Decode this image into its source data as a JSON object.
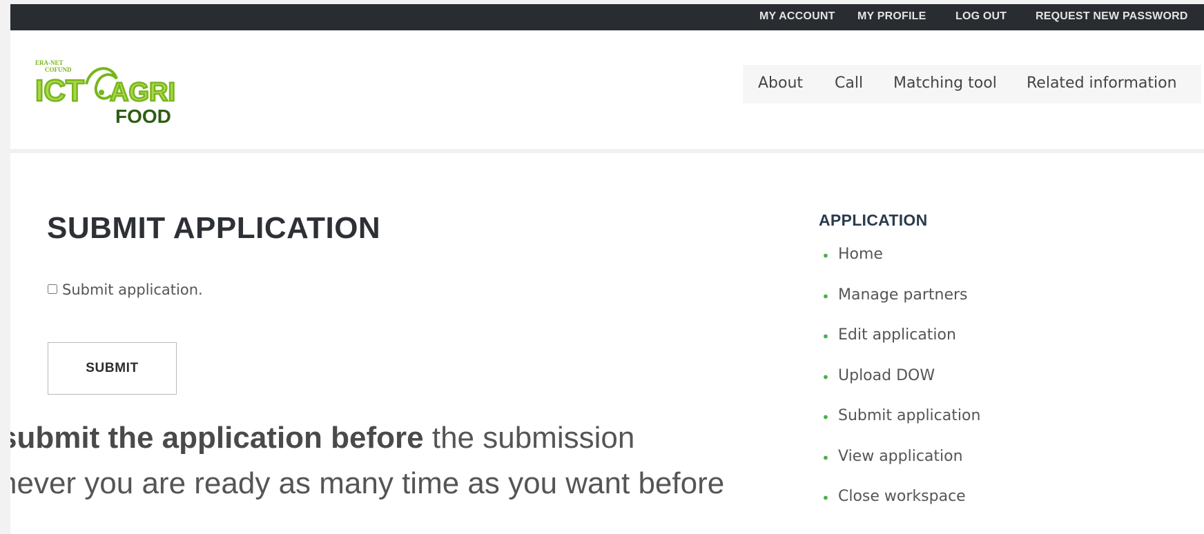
{
  "topbar": {
    "links": [
      {
        "label": "MY ACCOUNT"
      },
      {
        "label": "MY PROFILE"
      },
      {
        "label": "LOG OUT"
      },
      {
        "label": "REQUEST NEW PASSWORD"
      }
    ]
  },
  "logo": {
    "line1": "ERA-NET",
    "line2": "COFUND",
    "main_left": "ICT",
    "main_right": "AGRI",
    "sub": "FOOD",
    "brand_color": "#78b51c",
    "dark_color": "#2e5d14"
  },
  "nav": {
    "items": [
      {
        "label": "About"
      },
      {
        "label": "Call"
      },
      {
        "label": "Matching tool"
      },
      {
        "label": "Related information"
      }
    ]
  },
  "main": {
    "title": "SUBMIT APPLICATION",
    "checkbox_label": "Submit application.",
    "checkbox_checked": false,
    "submit_label": "SUBMIT"
  },
  "overlay": {
    "line1_bold": "submit the application before",
    "line1_rest": " the submission",
    "line2": "never you are ready as many time as you want before"
  },
  "sidebar": {
    "title": "APPLICATION",
    "items": [
      {
        "label": "Home"
      },
      {
        "label": "Manage partners"
      },
      {
        "label": "Edit application"
      },
      {
        "label": "Upload DOW"
      },
      {
        "label": "Submit application"
      },
      {
        "label": "View application"
      },
      {
        "label": "Close workspace"
      }
    ],
    "bullet_color": "#4caf50"
  },
  "colors": {
    "topbar_bg": "#292c31",
    "page_bg": "#ffffff",
    "nav_bg": "#f6f6f6"
  }
}
